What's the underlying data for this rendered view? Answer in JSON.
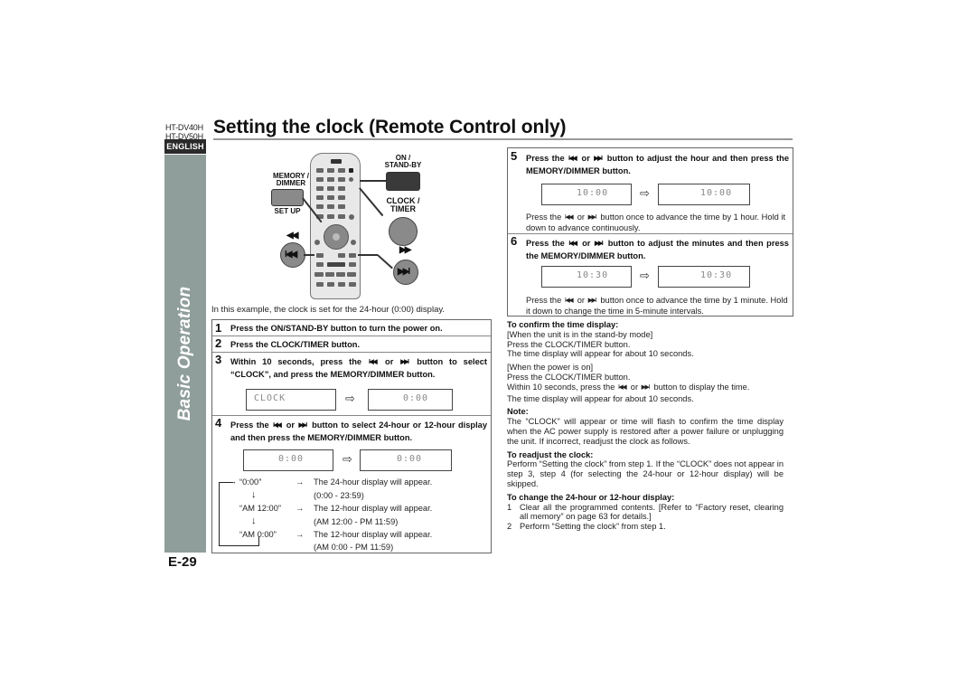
{
  "header": {
    "models": [
      "HT-DV40H",
      "HT-DV50H"
    ],
    "title": "Setting the clock (Remote Control only)",
    "language_badge": "ENGLISH"
  },
  "sidebar": {
    "section": "Basic Operation",
    "color": "#8f9e9a"
  },
  "page_number": "E-29",
  "remote": {
    "labels": {
      "memory_dimmer": "MEMORY / DIMMER",
      "set_up": "SET UP",
      "on_standby": "ON / STAND-BY",
      "clock_timer": "CLOCK / TIMER"
    },
    "icons": {
      "rewind": "◀◀",
      "prev": "I◀◀",
      "fast_forward": "▶▶",
      "next": "▶▶I"
    }
  },
  "example_note": "In this example, the clock is set for the 24-hour (0:00) display.",
  "steps": [
    {
      "num": "1",
      "text": "Press the ON/STAND-BY button to turn the power on."
    },
    {
      "num": "2",
      "text": "Press the CLOCK/TIMER button."
    },
    {
      "num": "3",
      "text_a": "Within 10 seconds, press the",
      "text_or": "or",
      "text_b": "button to select “CLOCK”, and press the MEMORY/DIMMER button.",
      "display_from": "CLOCK",
      "display_to": "0:00"
    },
    {
      "num": "4",
      "text_a": "Press the",
      "text_or": "or",
      "text_b": "button to select 24-hour or 12-hour display and then press the MEMORY/DIMMER button.",
      "display_from": "0:00",
      "display_to": "0:00",
      "cycle": [
        {
          "value": "“0:00”",
          "result": "The 24-hour display will appear.",
          "range": "(0:00 - 23:59)"
        },
        {
          "value": "“AM 12:00”",
          "result": "The 12-hour display will appear.",
          "range": "(AM 12:00 - PM 11:59)"
        },
        {
          "value": "“AM 0:00”",
          "result": "The 12-hour display will appear.",
          "range": "(AM 0:00 - PM 11:59)"
        }
      ]
    },
    {
      "num": "5",
      "text_a": "Press the",
      "text_or": "or",
      "text_b": "button to adjust the hour and then press the MEMORY/DIMMER button.",
      "display_from": "10:00",
      "display_to": "10:00",
      "sub_a": "Press the",
      "sub_or": "or",
      "sub_b": "button once to advance the time by 1 hour. Hold it down to advance continuously."
    },
    {
      "num": "6",
      "text_a": "Press the",
      "text_or": "or",
      "text_b": "button to adjust the minutes and then press the MEMORY/DIMMER button.",
      "display_from": "10:30",
      "display_to": "10:30",
      "sub_a": "Press the",
      "sub_or": "or",
      "sub_b": "button once to advance the time by 1 minute. Hold it down to change the time in 5-minute intervals."
    }
  ],
  "notes": {
    "confirm_heading": "To confirm the time display:",
    "standby_lines": [
      "[When the unit is in the stand-by mode]",
      "Press the CLOCK/TIMER button.",
      "The time display will appear for about 10 seconds."
    ],
    "power_on_lines": [
      "[When the power is on]",
      "Press the CLOCK/TIMER button."
    ],
    "power_on_within_a": "Within 10 seconds, press the",
    "power_on_within_or": "or",
    "power_on_within_b": "button to display the time.",
    "power_on_last": "The time display will appear for about 10 seconds.",
    "note_heading": "Note:",
    "note_text": "The “CLOCK” will appear or time will flash to confirm the time display when the AC power supply is restored after a power failure or unplugging the unit. If incorrect, readjust the clock as follows.",
    "readjust_heading": "To readjust the clock:",
    "readjust_text": "Perform “Setting the clock” from step 1. If the “CLOCK” does not appear in step 3, step 4 (for selecting the 24-hour or 12-hour display) will be skipped.",
    "change_heading": "To change the 24-hour or 12-hour display:",
    "change_items": [
      {
        "n": "1",
        "text": "Clear all the programmed contents. [Refer to “Factory reset, clearing all memory” on page 63 for details.]"
      },
      {
        "n": "2",
        "text": "Perform “Setting the clock” from step 1."
      }
    ]
  },
  "icons": {
    "prev": "I◀◀",
    "next": "▶▶I",
    "display_arrow": "⇨",
    "flow_arrow": "→",
    "down_arrow": "↓"
  }
}
